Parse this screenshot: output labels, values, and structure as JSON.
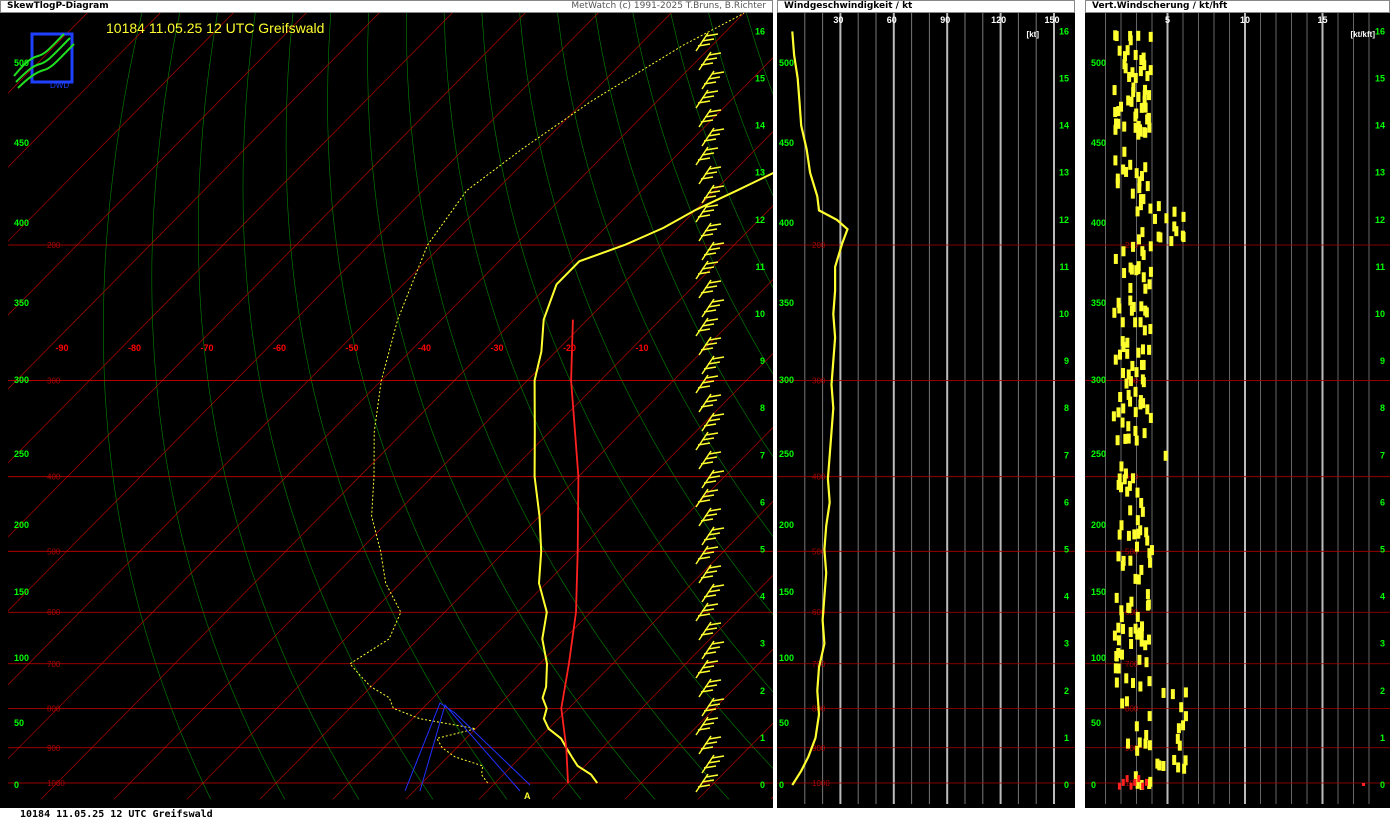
{
  "panels": {
    "skewt": {
      "title": "SkewTlogP-Diagram",
      "credit": "MetWatch  (c) 1991-2025 T.Bruns, B.Richter"
    },
    "wind": {
      "title": "Windgeschwindigkeit / kt"
    },
    "shear": {
      "title": "Vert.Windscherung / kt/hft"
    }
  },
  "header_text": "10184 11.05.25 12 UTC Greifswald",
  "footer_text": "10184 11.05.25 12 UTC Greifswald",
  "logo_text": "DWD",
  "colors": {
    "background": "#000000",
    "isobar": "#cc0000",
    "isotherm": "#cc0000",
    "dry_adiabat": "#00aa00",
    "sounding": "#ffff30",
    "parcel": "#ff2020",
    "axis_labels": "#00ff00",
    "temp_labels": "#ff0000"
  },
  "chart_data": [
    {
      "type": "line",
      "name": "skewt",
      "left_axis_ticks": [
        "500",
        "450",
        "400",
        "350",
        "300",
        "250",
        "200",
        "150",
        "100",
        "50",
        "0"
      ],
      "right_axis_ticks": [
        "16",
        "15",
        "14",
        "13",
        "12",
        "11",
        "10",
        "9",
        "8",
        "7",
        "6",
        "5",
        "4",
        "3",
        "2",
        "1",
        "0"
      ],
      "isobar_labels": [
        "200",
        "300",
        "400",
        "500",
        "600",
        "700",
        "800",
        "900",
        "1000"
      ],
      "temperature_labels": [
        "-90",
        "-80",
        "-70",
        "-60",
        "-50",
        "-40",
        "-30",
        "-20",
        "-10"
      ],
      "marker_label": "A",
      "temperature_profile": [
        [
          1000,
          14
        ],
        [
          975,
          12
        ],
        [
          950,
          9
        ],
        [
          925,
          7
        ],
        [
          900,
          5
        ],
        [
          875,
          3
        ],
        [
          850,
          0
        ],
        [
          825,
          -2
        ],
        [
          800,
          -3
        ],
        [
          775,
          -5
        ],
        [
          750,
          -6
        ],
        [
          700,
          -9
        ],
        [
          650,
          -13
        ],
        [
          600,
          -16
        ],
        [
          550,
          -21
        ],
        [
          500,
          -25
        ],
        [
          450,
          -30
        ],
        [
          400,
          -36
        ],
        [
          350,
          -42
        ],
        [
          300,
          -49
        ],
        [
          275,
          -52
        ],
        [
          250,
          -56
        ],
        [
          225,
          -59
        ],
        [
          210,
          -59
        ],
        [
          200,
          -55
        ],
        [
          190,
          -52
        ],
        [
          180,
          -50
        ],
        [
          170,
          -47
        ],
        [
          160,
          -44
        ],
        [
          150,
          -42
        ],
        [
          140,
          -39
        ],
        [
          130,
          -37
        ],
        [
          120,
          -35
        ],
        [
          110,
          -33
        ],
        [
          100,
          -31
        ]
      ],
      "dewpoint_profile": [
        [
          1000,
          -1
        ],
        [
          975,
          -3
        ],
        [
          950,
          -4
        ],
        [
          925,
          -9
        ],
        [
          900,
          -12
        ],
        [
          875,
          -14
        ],
        [
          850,
          -10
        ],
        [
          825,
          -19
        ],
        [
          800,
          -24
        ],
        [
          775,
          -26
        ],
        [
          750,
          -30
        ],
        [
          725,
          -33
        ],
        [
          700,
          -36
        ],
        [
          650,
          -34
        ],
        [
          600,
          -36
        ],
        [
          550,
          -42
        ],
        [
          500,
          -47
        ],
        [
          450,
          -53
        ],
        [
          400,
          -58
        ],
        [
          350,
          -64
        ],
        [
          300,
          -70
        ],
        [
          250,
          -76
        ],
        [
          200,
          -82
        ],
        [
          170,
          -84
        ],
        [
          150,
          -82
        ],
        [
          130,
          -79
        ],
        [
          110,
          -74
        ],
        [
          100,
          -70
        ]
      ],
      "parcel_line": [
        [
          1000,
          10
        ],
        [
          900,
          5
        ],
        [
          800,
          -1
        ],
        [
          700,
          -6
        ],
        [
          600,
          -12
        ],
        [
          500,
          -20
        ],
        [
          400,
          -30
        ],
        [
          300,
          -44
        ],
        [
          250,
          -52
        ]
      ]
    },
    {
      "type": "line",
      "name": "wind",
      "x_ticks": [
        "30",
        "60",
        "90",
        "120",
        "150"
      ],
      "x_unit": "[kt]",
      "xlim": [
        0,
        160
      ],
      "left_axis_ticks": [
        "500",
        "450",
        "400",
        "350",
        "300",
        "250",
        "200",
        "150",
        "100",
        "50",
        "0"
      ],
      "isobar_labels": [
        "200",
        "300",
        "400",
        "500",
        "600",
        "700",
        "800",
        "900",
        "1000"
      ],
      "right_axis_ticks": [
        "16",
        "15",
        "14",
        "13",
        "12",
        "11",
        "10",
        "9",
        "8",
        "7",
        "6",
        "5",
        "4",
        "3",
        "2",
        "1",
        "0"
      ],
      "profile_kt_vs_height_km": [
        [
          0,
          3
        ],
        [
          0.3,
          8
        ],
        [
          0.6,
          12
        ],
        [
          1.0,
          16
        ],
        [
          1.5,
          18
        ],
        [
          2.0,
          17
        ],
        [
          2.5,
          18
        ],
        [
          3.0,
          21
        ],
        [
          3.5,
          20
        ],
        [
          4.0,
          21
        ],
        [
          4.5,
          22
        ],
        [
          5.0,
          21
        ],
        [
          5.5,
          22
        ],
        [
          6.0,
          24
        ],
        [
          6.5,
          23
        ],
        [
          7.0,
          24
        ],
        [
          7.5,
          25
        ],
        [
          8.0,
          26
        ],
        [
          8.5,
          25
        ],
        [
          9.0,
          26
        ],
        [
          9.5,
          27
        ],
        [
          10.0,
          26
        ],
        [
          10.5,
          27
        ],
        [
          11.0,
          27
        ],
        [
          11.5,
          31
        ],
        [
          11.8,
          34
        ],
        [
          12.0,
          28
        ],
        [
          12.2,
          18
        ],
        [
          12.5,
          17
        ],
        [
          13.0,
          13
        ],
        [
          13.5,
          11
        ],
        [
          14.0,
          8
        ],
        [
          14.5,
          7
        ],
        [
          15.0,
          6
        ],
        [
          15.5,
          4
        ],
        [
          16.0,
          3
        ]
      ]
    },
    {
      "type": "scatter",
      "name": "shear",
      "x_ticks": [
        "5",
        "10",
        "15"
      ],
      "x_unit": "[kt/kft]",
      "xlim": [
        0,
        18
      ],
      "left_axis_ticks": [
        "500",
        "450",
        "400",
        "350",
        "300",
        "250",
        "200",
        "150",
        "100",
        "50",
        "0"
      ],
      "isobar_labels": [
        "200",
        "300",
        "400",
        "500",
        "600",
        "700",
        "800",
        "900",
        "1000"
      ],
      "right_axis_ticks": [
        "16",
        "15",
        "14",
        "13",
        "12",
        "11",
        "10",
        "9",
        "8",
        "7",
        "6",
        "5",
        "4",
        "3",
        "2",
        "1",
        "0"
      ]
    }
  ]
}
